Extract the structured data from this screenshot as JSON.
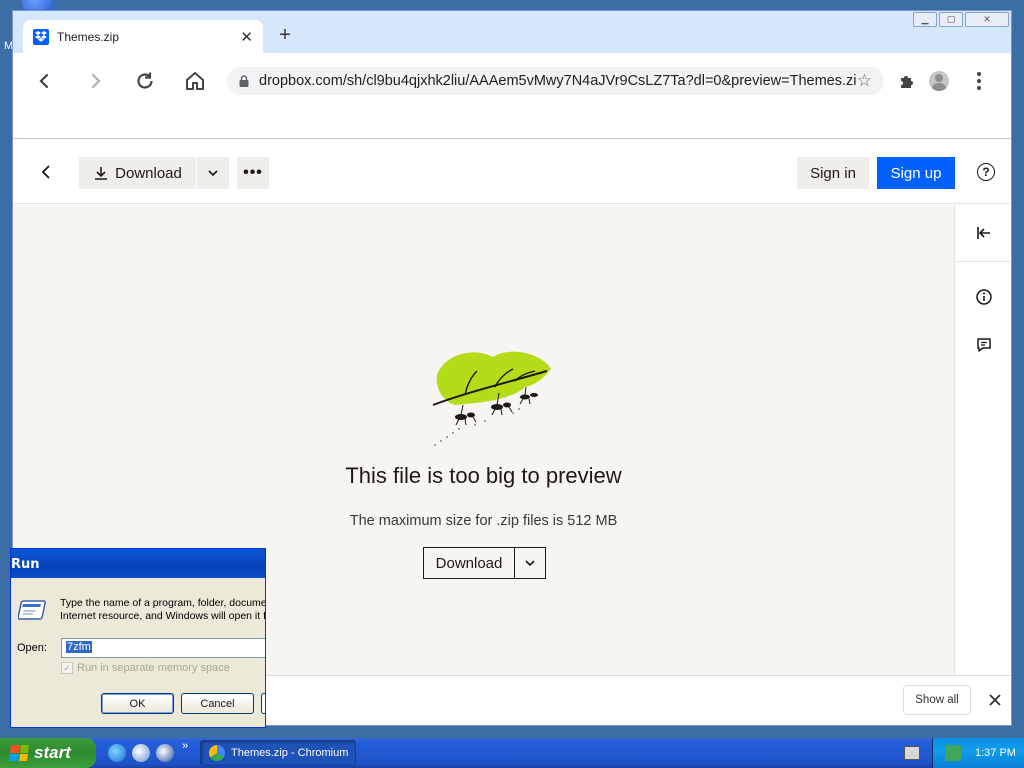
{
  "desktop": {
    "icon_label": "M"
  },
  "browser": {
    "tab": {
      "title": "Themes.zip",
      "close": "✕"
    },
    "new_tab": "+",
    "window_controls": {
      "minimize": "▁",
      "maximize": "▢",
      "close": "✕"
    },
    "url": "dropbox.com/sh/cl9bu4qjxhk2liu/AAAem5vMwy7N4aJVr9CsLZ7Ta?dl=0&preview=Themes.zip"
  },
  "dropbox": {
    "toolbar": {
      "download_label": "Download",
      "more_label": "•••",
      "signin_label": "Sign in",
      "signup_label": "Sign up",
      "help_label": "?"
    },
    "preview": {
      "title": "This file is too big to preview",
      "subtitle": "The maximum size for .zip files is 512 MB",
      "download_label": "Download"
    }
  },
  "shelf": {
    "show_all_label": "Show all"
  },
  "run_dialog": {
    "title": "Run",
    "description_line1": "Type the name of a program, folder, document, or",
    "description_line2": "Internet resource, and Windows will open it for you.",
    "open_label": "Open:",
    "open_value": "7zfm",
    "checkbox_label": "Run in separate memory space",
    "ok_label": "OK",
    "cancel_label": "Cancel"
  },
  "taskbar": {
    "start_label": "start",
    "quicklaunch_more": "»",
    "task_label": "Themes.zip - Chromium",
    "clock": "1:37 PM"
  },
  "colors": {
    "dropbox_blue": "#0061fe",
    "xp_taskbar": "#245edb",
    "xp_start_green": "#3c9a3c"
  }
}
